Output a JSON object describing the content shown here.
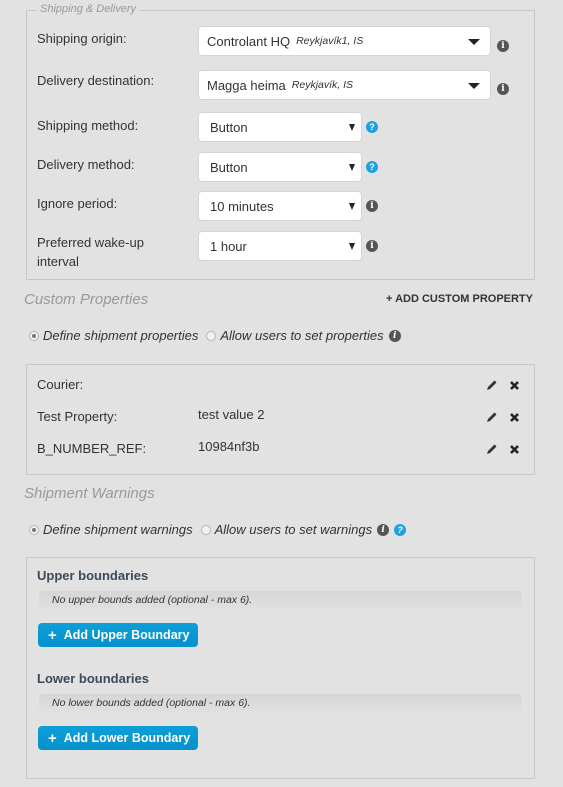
{
  "shipping_delivery": {
    "legend": "Shipping & Delivery",
    "fields": [
      {
        "label": "Shipping origin:",
        "value": "Controlant HQ",
        "sub": "Reykjavík1, IS",
        "icon": "info-icon"
      },
      {
        "label": "Delivery destination:",
        "value": "Magga heima",
        "sub": "Reykjavík, IS",
        "icon": "info-icon"
      },
      {
        "label": "Shipping method:",
        "value": "Button",
        "icon": "help-icon"
      },
      {
        "label": "Delivery method:",
        "value": "Button",
        "icon": "help-icon"
      },
      {
        "label": "Ignore period:",
        "value": "10 minutes",
        "icon": "info-icon"
      },
      {
        "label_line1": "Preferred wake-up",
        "label_line2": "interval",
        "value": "1 hour",
        "icon": "info-icon"
      }
    ]
  },
  "custom_properties": {
    "title": "Custom Properties",
    "add_label": "+ ADD CUSTOM PROPERTY",
    "radio_define": "Define shipment properties",
    "radio_allow": "Allow users to set properties",
    "selected": "define",
    "properties": [
      {
        "key": "Courier:",
        "value": ""
      },
      {
        "key": "Test Property:",
        "value": "test value 2"
      },
      {
        "key": "B_NUMBER_REF:",
        "value": "10984nf3b"
      }
    ]
  },
  "shipment_warnings": {
    "title": "Shipment Warnings",
    "radio_define": "Define shipment warnings",
    "radio_allow": "Allow users to set warnings",
    "selected": "define",
    "upper": {
      "title": "Upper boundaries",
      "empty": "No upper bounds added (optional - max 6).",
      "button": "Add Upper Boundary"
    },
    "lower": {
      "title": "Lower boundaries",
      "empty": "No lower bounds added (optional - max 6).",
      "button": "Add Lower Boundary"
    }
  },
  "colors": {
    "accent": "#0d9fd8",
    "help_icon": "#1ea1e3",
    "background": "#e2e2e2"
  }
}
